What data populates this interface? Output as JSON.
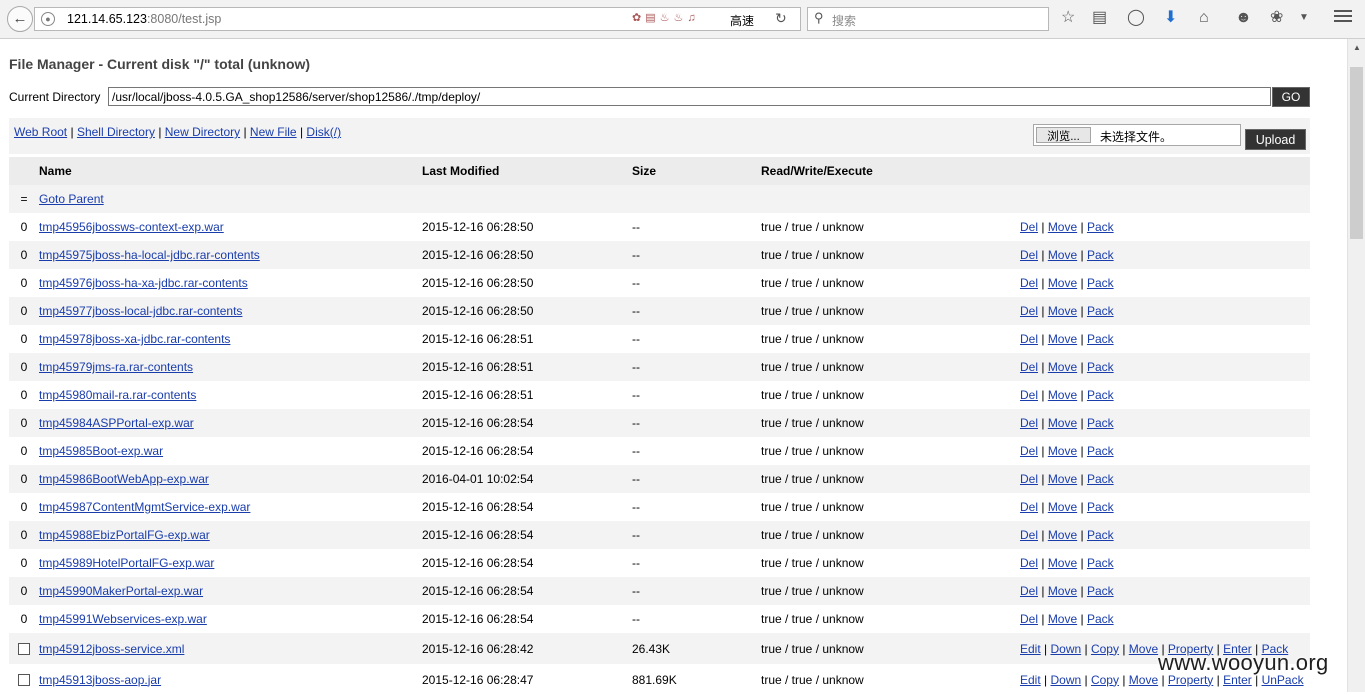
{
  "browser": {
    "url_host": "121.14.65.123",
    "url_rest": ":8080/test.jsp",
    "addon_label": "高速",
    "search_placeholder": "搜索"
  },
  "page": {
    "title": "File Manager - Current disk \"/\" total (unknow)",
    "dir_label": "Current Directory",
    "dir_value": "/usr/local/jboss-4.0.5.GA_shop12586/server/shop12586/./tmp/deploy/",
    "go_label": "GO",
    "links": [
      "Web Root",
      "Shell Directory",
      "New Directory",
      "New File",
      "Disk(/)"
    ],
    "browse_label": "浏览...",
    "no_file_label": "未选择文件。",
    "upload_label": "Upload"
  },
  "table": {
    "headers": [
      "Name",
      "Last Modified",
      "Size",
      "Read/Write/Execute"
    ],
    "parent_symbol": "=",
    "parent_label": "Goto Parent",
    "dir_rows": [
      {
        "icon": "0",
        "name": "tmp45956jbossws-context-exp.war",
        "modified": "2015-12-16 06:28:50",
        "size": "--",
        "rwx": "true / true / unknow"
      },
      {
        "icon": "0",
        "name": "tmp45975jboss-ha-local-jdbc.rar-contents",
        "modified": "2015-12-16 06:28:50",
        "size": "--",
        "rwx": "true / true / unknow"
      },
      {
        "icon": "0",
        "name": "tmp45976jboss-ha-xa-jdbc.rar-contents",
        "modified": "2015-12-16 06:28:50",
        "size": "--",
        "rwx": "true / true / unknow"
      },
      {
        "icon": "0",
        "name": "tmp45977jboss-local-jdbc.rar-contents",
        "modified": "2015-12-16 06:28:50",
        "size": "--",
        "rwx": "true / true / unknow"
      },
      {
        "icon": "0",
        "name": "tmp45978jboss-xa-jdbc.rar-contents",
        "modified": "2015-12-16 06:28:51",
        "size": "--",
        "rwx": "true / true / unknow"
      },
      {
        "icon": "0",
        "name": "tmp45979jms-ra.rar-contents",
        "modified": "2015-12-16 06:28:51",
        "size": "--",
        "rwx": "true / true / unknow"
      },
      {
        "icon": "0",
        "name": "tmp45980mail-ra.rar-contents",
        "modified": "2015-12-16 06:28:51",
        "size": "--",
        "rwx": "true / true / unknow"
      },
      {
        "icon": "0",
        "name": "tmp45984ASPPortal-exp.war",
        "modified": "2015-12-16 06:28:54",
        "size": "--",
        "rwx": "true / true / unknow"
      },
      {
        "icon": "0",
        "name": "tmp45985Boot-exp.war",
        "modified": "2015-12-16 06:28:54",
        "size": "--",
        "rwx": "true / true / unknow"
      },
      {
        "icon": "0",
        "name": "tmp45986BootWebApp-exp.war",
        "modified": "2016-04-01 10:02:54",
        "size": "--",
        "rwx": "true / true / unknow"
      },
      {
        "icon": "0",
        "name": "tmp45987ContentMgmtService-exp.war",
        "modified": "2015-12-16 06:28:54",
        "size": "--",
        "rwx": "true / true / unknow"
      },
      {
        "icon": "0",
        "name": "tmp45988EbizPortalFG-exp.war",
        "modified": "2015-12-16 06:28:54",
        "size": "--",
        "rwx": "true / true / unknow"
      },
      {
        "icon": "0",
        "name": "tmp45989HotelPortalFG-exp.war",
        "modified": "2015-12-16 06:28:54",
        "size": "--",
        "rwx": "true / true / unknow"
      },
      {
        "icon": "0",
        "name": "tmp45990MakerPortal-exp.war",
        "modified": "2015-12-16 06:28:54",
        "size": "--",
        "rwx": "true / true / unknow"
      },
      {
        "icon": "0",
        "name": "tmp45991Webservices-exp.war",
        "modified": "2015-12-16 06:28:54",
        "size": "--",
        "rwx": "true / true / unknow"
      }
    ],
    "dir_actions": [
      "Del",
      "Move",
      "Pack"
    ],
    "file_rows": [
      {
        "name": "tmp45912jboss-service.xml",
        "modified": "2015-12-16 06:28:42",
        "size": "26.43K",
        "rwx": "true / true / unknow",
        "actions": [
          "Edit",
          "Down",
          "Copy",
          "Move",
          "Property",
          "Enter",
          "Pack"
        ]
      },
      {
        "name": "tmp45913jboss-aop.jar",
        "modified": "2015-12-16 06:28:47",
        "size": "881.69K",
        "rwx": "true / true / unknow",
        "actions": [
          "Edit",
          "Down",
          "Copy",
          "Move",
          "Property",
          "Enter",
          "UnPack"
        ]
      }
    ]
  },
  "watermark": "www.wooyun.org"
}
